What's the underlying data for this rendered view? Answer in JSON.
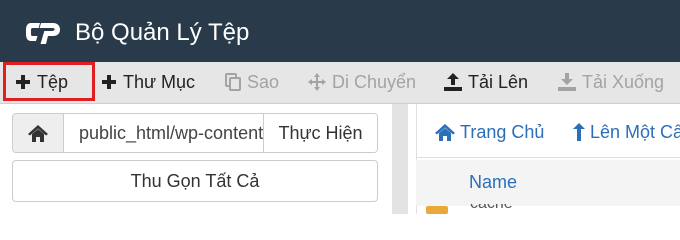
{
  "app": {
    "title": "Bộ Quản Lý Tệp",
    "logo_icon": "cpanel-logo"
  },
  "toolbar": {
    "items": [
      {
        "label": "Tệp",
        "icon": "plus-icon",
        "enabled": true,
        "highlighted": true
      },
      {
        "label": "Thư Mục",
        "icon": "plus-icon",
        "enabled": true
      },
      {
        "label": "Sao",
        "icon": "copy-icon",
        "enabled": false
      },
      {
        "label": "Di Chuyển",
        "icon": "move-icon",
        "enabled": false
      },
      {
        "label": "Tải Lên",
        "icon": "upload-icon",
        "enabled": true
      },
      {
        "label": "Tải Xuống",
        "icon": "download-icon",
        "enabled": false
      }
    ],
    "highlight_color": "#e02020"
  },
  "sidebar": {
    "path_value": "public_html/wp-content",
    "go_label": "Thực Hiện",
    "collapse_label": "Thu Gọn Tất Cả"
  },
  "main": {
    "nav": {
      "home_label": "Trang Chủ",
      "up_label": "Lên Một Cấp"
    },
    "table": {
      "columns": [
        "Name"
      ],
      "first_row_partial": "cache"
    }
  },
  "colors": {
    "header_bg": "#293a4a",
    "toolbar_bg": "#e6e6e6",
    "link": "#2a6fb8",
    "folder": "#e8a93a"
  }
}
